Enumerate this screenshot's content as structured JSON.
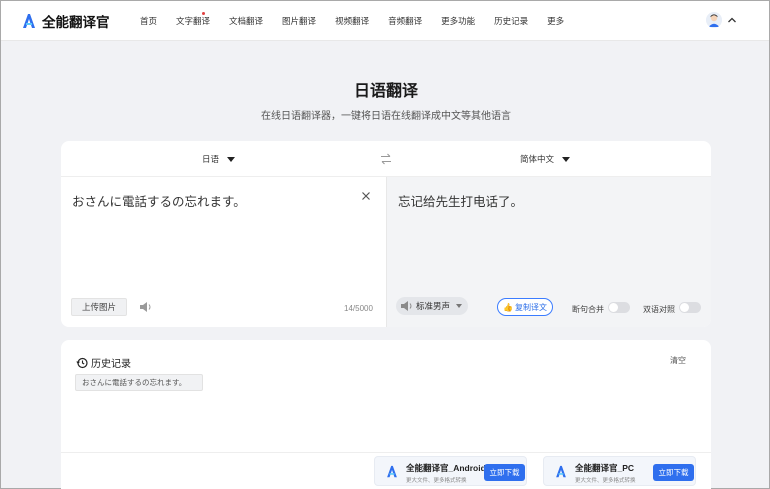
{
  "header": {
    "app_name": "全能翻译官",
    "nav": [
      "首页",
      "文字翻译",
      "文档翻译",
      "图片翻译",
      "视频翻译",
      "音频翻译",
      "更多功能",
      "历史记录",
      "更多"
    ]
  },
  "page": {
    "title": "日语翻译",
    "subtitle": "在线日语翻译器，一键将日语在线翻译成中文等其他语言"
  },
  "translator": {
    "source_lang": "日语",
    "target_lang": "简体中文",
    "source_text": "おさんに電話するの忘れます。",
    "target_text": "忘记给先生打电话了。",
    "upload_label": "上传图片",
    "char_count": "14/5000",
    "voice": "标准男声",
    "copy_label": "复制译文",
    "toggle_merge": "断句合并",
    "toggle_compare": "双语对照"
  },
  "history": {
    "title": "历史记录",
    "clear": "清空",
    "items": [
      "おさんに電話するの忘れます。"
    ]
  },
  "downloads": [
    {
      "name": "全能翻译官_Android",
      "sub": "更大文件、更多格式转换",
      "button": "立即下载"
    },
    {
      "name": "全能翻译官_PC",
      "sub": "更大文件、更多格式转换",
      "button": "立即下载"
    }
  ],
  "colors": {
    "accent": "#2f6fee",
    "background": "#f1f2f5"
  }
}
